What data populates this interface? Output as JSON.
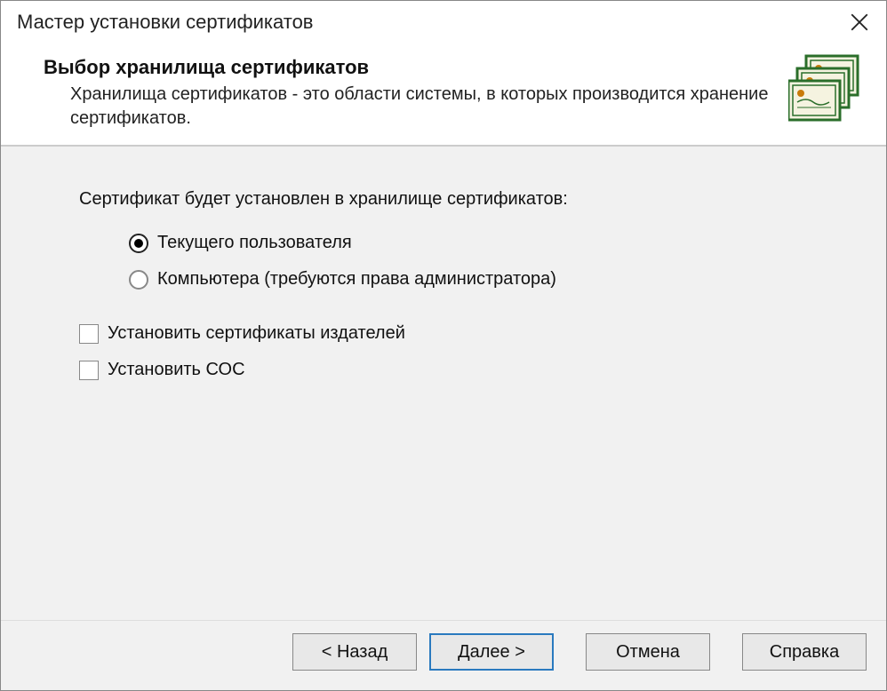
{
  "window": {
    "title": "Мастер установки сертификатов"
  },
  "header": {
    "title": "Выбор хранилища сертификатов",
    "description": "Хранилища сертификатов - это области системы, в которых производится хранение сертификатов."
  },
  "content": {
    "intro": "Сертификат будет установлен в хранилище сертификатов:",
    "radios": [
      {
        "label": "Текущего пользователя",
        "checked": true
      },
      {
        "label": "Компьютера (требуются права администратора)",
        "checked": false
      }
    ],
    "checkboxes": [
      {
        "label": "Установить сертификаты издателей",
        "checked": false
      },
      {
        "label": "Установить СОС",
        "checked": false
      }
    ]
  },
  "footer": {
    "back": "< Назад",
    "next": "Далее >",
    "cancel": "Отмена",
    "help": "Справка"
  }
}
